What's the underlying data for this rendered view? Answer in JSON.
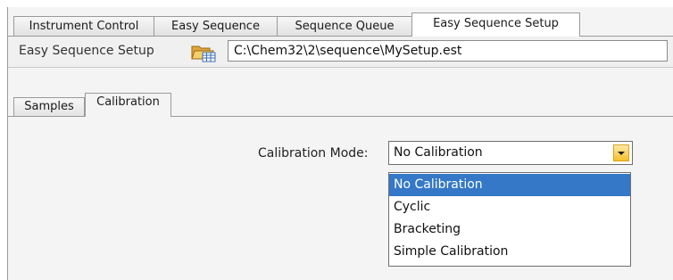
{
  "top_tabs": [
    {
      "label": "Instrument Control",
      "active": false
    },
    {
      "label": "Easy Sequence",
      "active": false
    },
    {
      "label": "Sequence Queue",
      "active": false
    },
    {
      "label": "Easy Sequence Setup",
      "active": true
    }
  ],
  "pathbar": {
    "label": "Easy Sequence Setup",
    "icon": "folder-open-icon",
    "path": "C:\\Chem32\\2\\sequence\\MySetup.est"
  },
  "inner_tabs": [
    {
      "label": "Samples",
      "active": false
    },
    {
      "label": "Calibration",
      "active": true
    }
  ],
  "calibration": {
    "label": "Calibration Mode:",
    "selected": "No Calibration",
    "options": [
      "No Calibration",
      "Cyclic",
      "Bracketing",
      "Simple Calibration"
    ],
    "highlighted_index": 0
  },
  "colors": {
    "highlight": "#3478c7",
    "dropdown_button": "#f6c02c"
  }
}
